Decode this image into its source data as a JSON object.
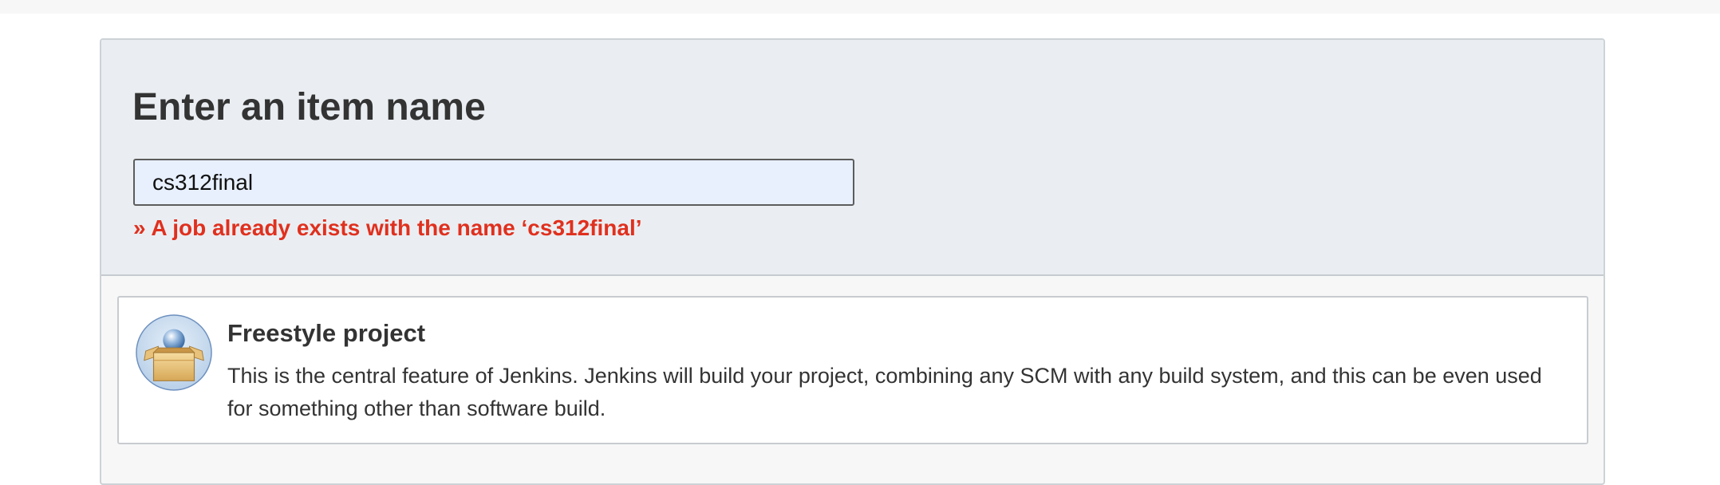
{
  "form": {
    "title": "Enter an item name",
    "item_name_value": "cs312final",
    "error_message": "» A job already exists with the name ‘cs312final’"
  },
  "item_types": [
    {
      "icon": "freestyle-package-icon",
      "title": "Freestyle project",
      "description": "This is the central feature of Jenkins. Jenkins will build your project, combining any SCM with any build system, and this can be even used for something other than software build."
    }
  ],
  "colors": {
    "error": "#e0301e",
    "header_bg": "#eaeef2",
    "input_bg": "#e8f0fe"
  }
}
